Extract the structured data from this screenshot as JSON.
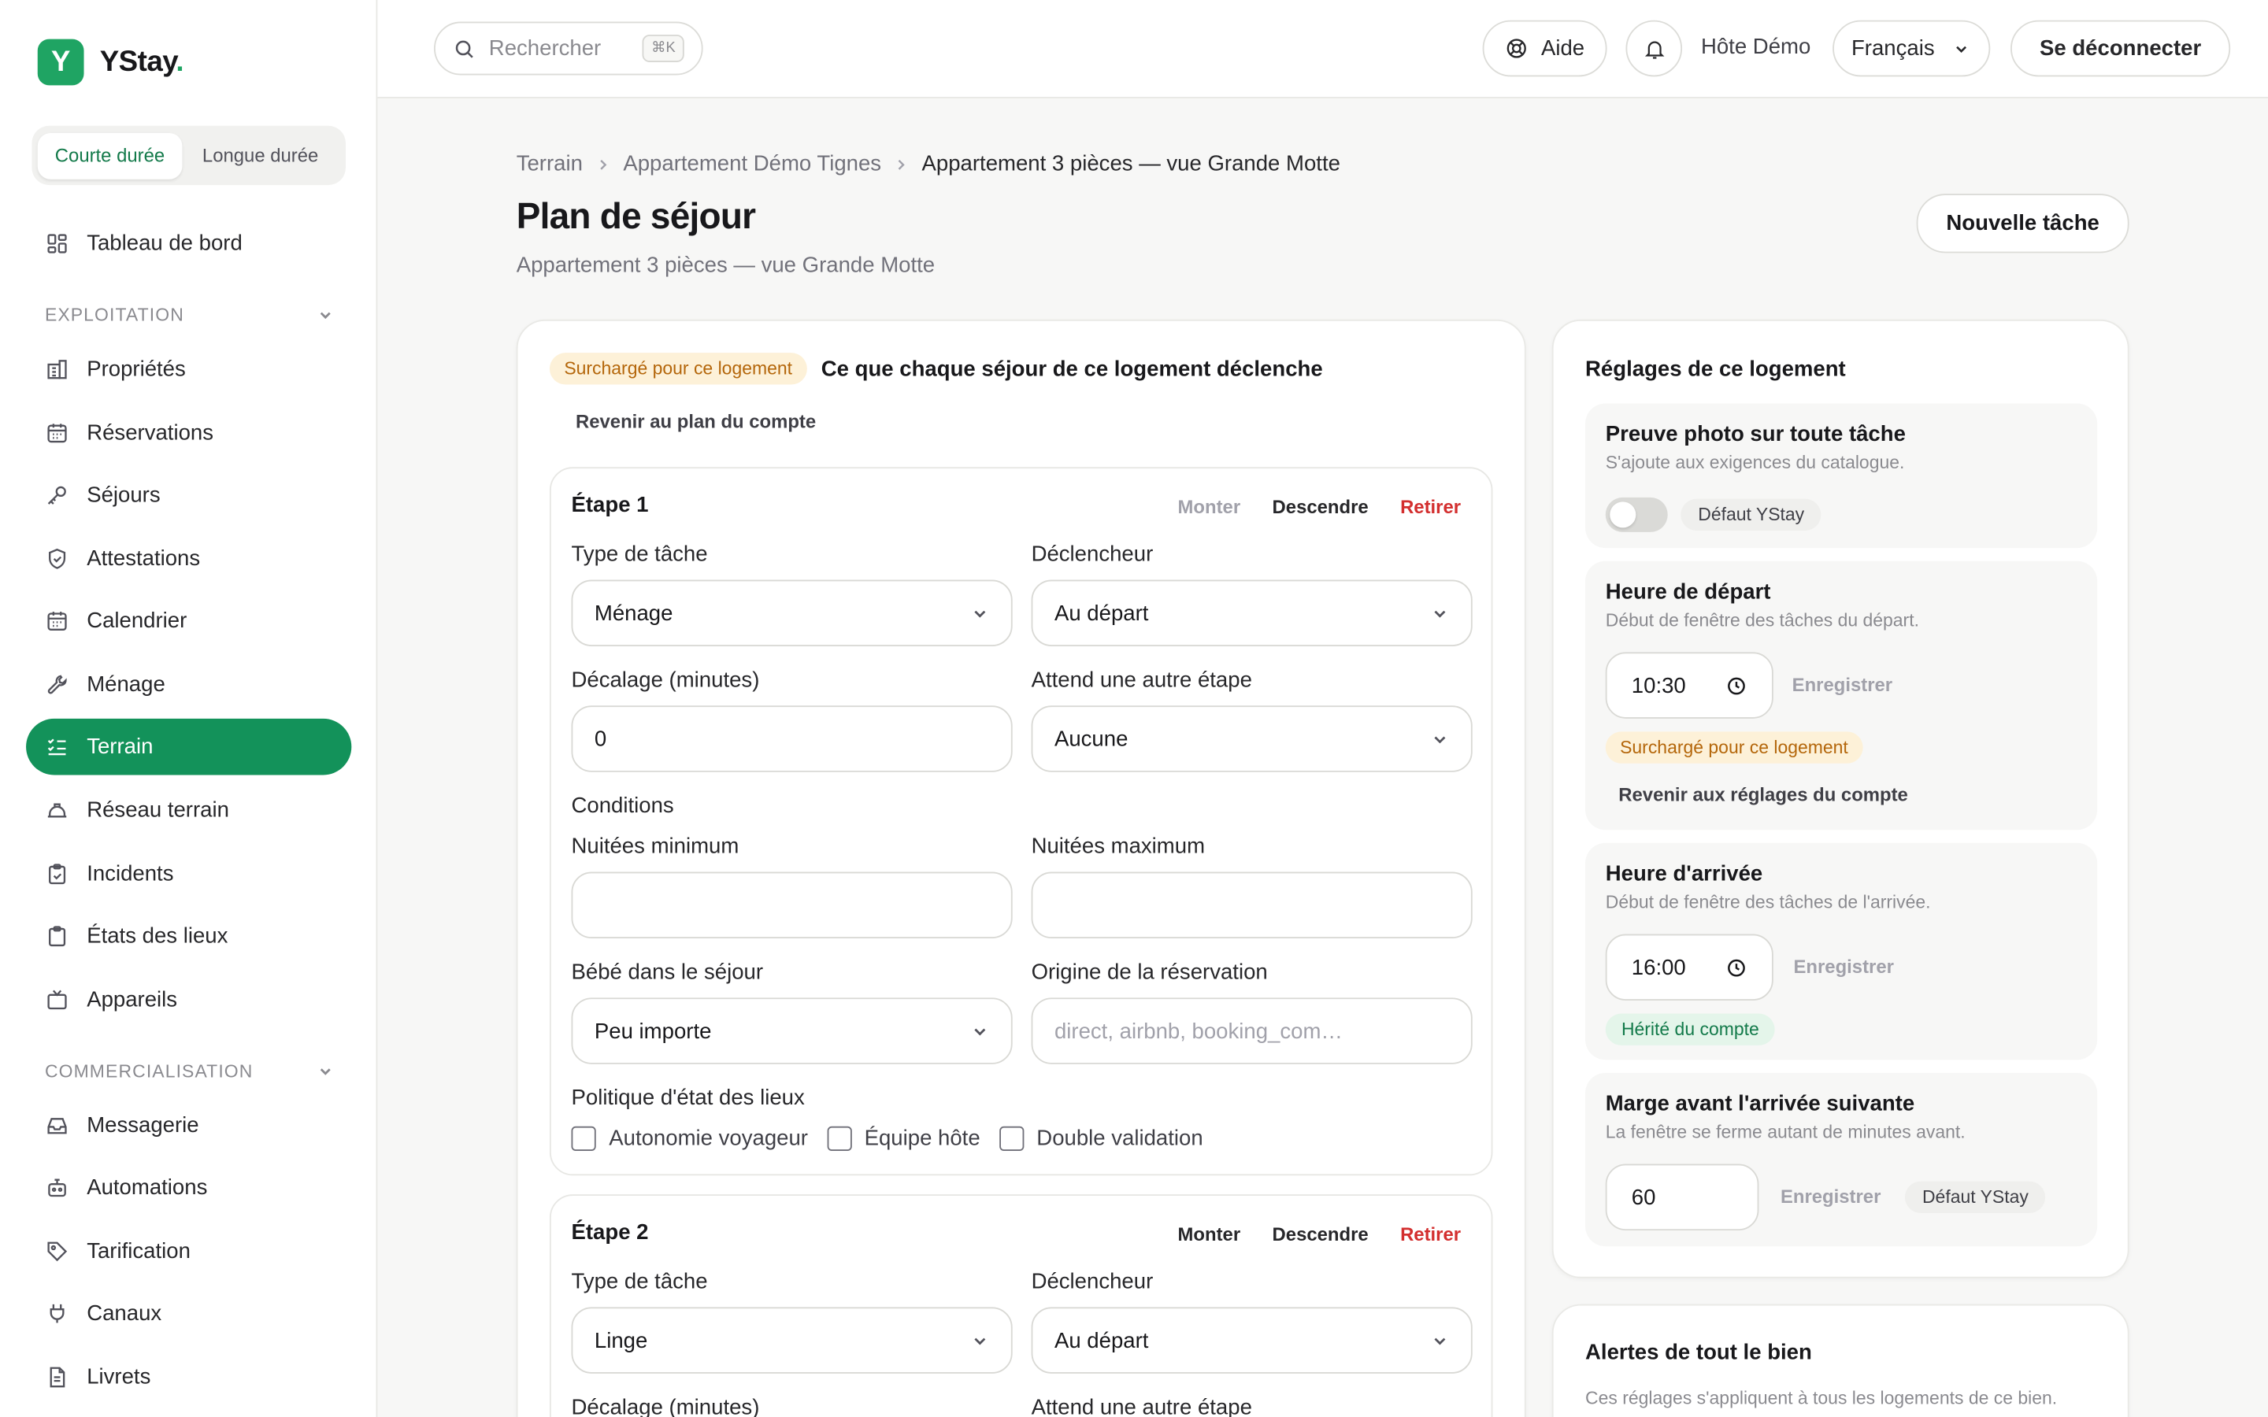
{
  "brand": {
    "logo_letter": "Y",
    "name": "YStay",
    "dot": "."
  },
  "duration": {
    "short": "Courte durée",
    "long": "Longue durée"
  },
  "nav": {
    "dashboard": "Tableau de bord",
    "section_ops": "EXPLOITATION",
    "properties": "Propriétés",
    "reservations": "Réservations",
    "stays": "Séjours",
    "attestations": "Attestations",
    "calendar": "Calendrier",
    "cleaning": "Ménage",
    "field": "Terrain",
    "field_network": "Réseau terrain",
    "incidents": "Incidents",
    "inspections": "États des lieux",
    "devices": "Appareils",
    "section_com": "COMMERCIALISATION",
    "messaging": "Messagerie",
    "automations": "Automations",
    "pricing": "Tarification",
    "channels": "Canaux",
    "booklets": "Livrets"
  },
  "topbar": {
    "search_placeholder": "Rechercher",
    "search_kbd": "⌘K",
    "help": "Aide",
    "user": "Hôte Démo",
    "language": "Français",
    "logout": "Se déconnecter"
  },
  "breadcrumb": {
    "root": "Terrain",
    "parent": "Appartement Démo Tignes",
    "current": "Appartement 3 pièces — vue Grande Motte"
  },
  "page": {
    "title": "Plan de séjour",
    "subtitle": "Appartement 3 pièces — vue Grande Motte",
    "new_task": "Nouvelle tâche"
  },
  "plan": {
    "override_badge": "Surchargé pour ce logement",
    "heading": "Ce que chaque séjour de ce logement déclenche",
    "revert": "Revenir au plan du compte",
    "step1": {
      "title": "Étape 1",
      "up": "Monter",
      "down": "Descendre",
      "remove": "Retirer",
      "task_type_label": "Type de tâche",
      "task_type": "Ménage",
      "trigger_label": "Déclencheur",
      "trigger": "Au départ",
      "offset_label": "Décalage (minutes)",
      "offset": "0",
      "wait_label": "Attend une autre étape",
      "wait": "Aucune",
      "conditions": "Conditions",
      "min_nights_label": "Nuitées minimum",
      "min_nights": "",
      "max_nights_label": "Nuitées maximum",
      "max_nights": "",
      "baby_label": "Bébé dans le séjour",
      "baby": "Peu importe",
      "origin_label": "Origine de la réservation",
      "origin_placeholder": "direct, airbnb, booking_com…",
      "policy_label": "Politique d'état des lieux",
      "policy_1": "Autonomie voyageur",
      "policy_2": "Équipe hôte",
      "policy_3": "Double validation"
    },
    "step2": {
      "title": "Étape 2",
      "up": "Monter",
      "down": "Descendre",
      "remove": "Retirer",
      "task_type_label": "Type de tâche",
      "task_type": "Linge",
      "trigger_label": "Déclencheur",
      "trigger": "Au départ",
      "offset_label": "Décalage (minutes)",
      "wait_label": "Attend une autre étape"
    }
  },
  "settings": {
    "title": "Réglages de ce logement",
    "photo": {
      "title": "Preuve photo sur toute tâche",
      "desc": "S'ajoute aux exigences du catalogue.",
      "badge": "Défaut YStay",
      "enabled": false
    },
    "departure": {
      "title": "Heure de départ",
      "desc": "Début de fenêtre des tâches du départ.",
      "value": "10:30",
      "save": "Enregistrer",
      "badge": "Surchargé pour ce logement",
      "revert": "Revenir aux réglages du compte"
    },
    "arrival": {
      "title": "Heure d'arrivée",
      "desc": "Début de fenêtre des tâches de l'arrivée.",
      "value": "16:00",
      "save": "Enregistrer",
      "badge": "Hérité du compte"
    },
    "margin": {
      "title": "Marge avant l'arrivée suivante",
      "desc": "La fenêtre se ferme autant de minutes avant.",
      "value": "60",
      "save": "Enregistrer",
      "badge": "Défaut YStay"
    }
  },
  "alerts": {
    "title": "Alertes de tout le bien",
    "desc": "Ces réglages s'appliquent à tous les logements de ce bien."
  },
  "colors": {
    "accent": "#13925a",
    "danger": "#d32f2f",
    "amber": "#b4660a"
  }
}
